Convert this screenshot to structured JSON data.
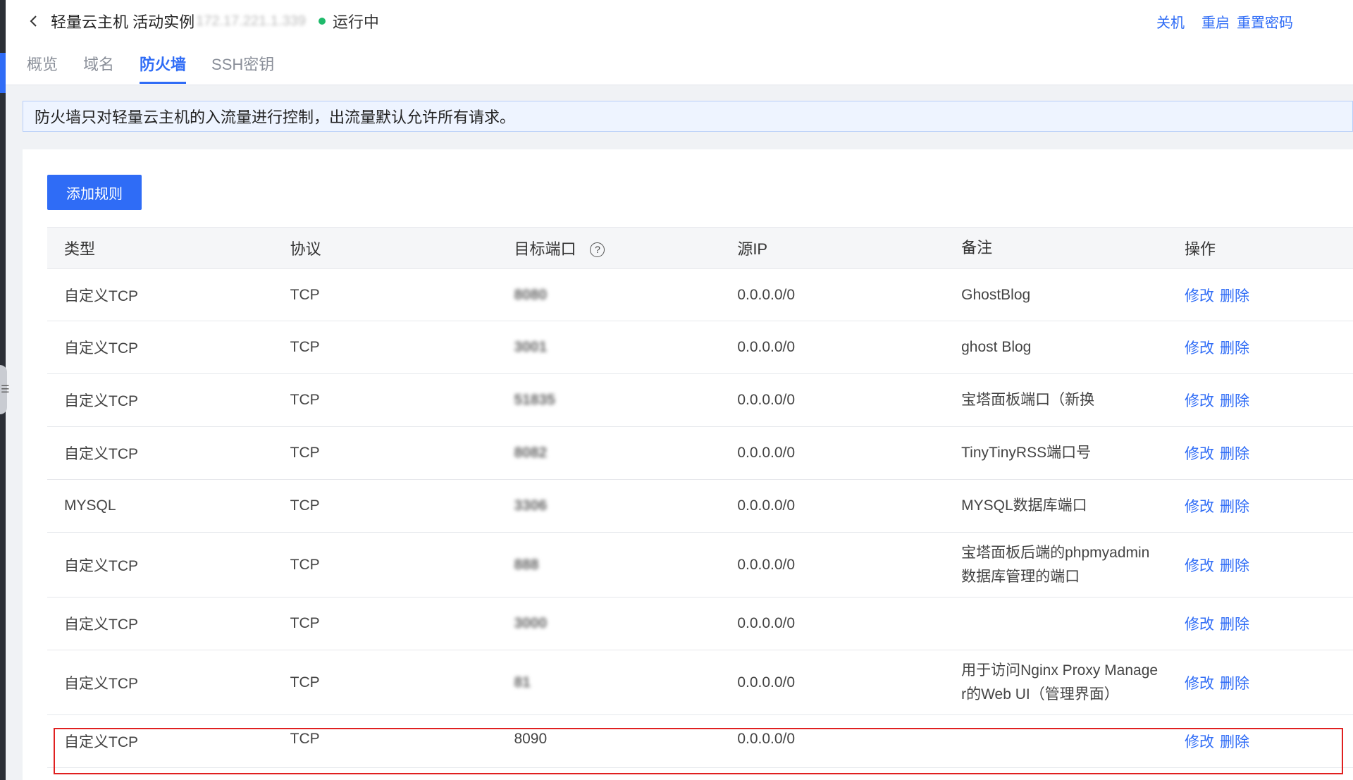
{
  "header": {
    "title": "轻量云主机 活动实例",
    "instance_id": "172.17.221.1.339",
    "status": "运行中",
    "actions": {
      "shutdown": "关机",
      "restart": "重启",
      "reset_password": "重置密码"
    }
  },
  "tabs": [
    "概览",
    "域名",
    "防火墙",
    "SSH密钥"
  ],
  "notice": "防火墙只对轻量云主机的入流量进行控制，出流量默认允许所有请求。",
  "add_rule_button": "添加规则",
  "table": {
    "columns": [
      "类型",
      "协议",
      "目标端口",
      "源IP",
      "备注",
      "操作"
    ],
    "edit_label": "修改",
    "delete_label": "删除",
    "rows": [
      {
        "type": "自定义TCP",
        "protocol": "TCP",
        "port": "8080",
        "source": "0.0.0.0/0",
        "note": "GhostBlog",
        "note2": ""
      },
      {
        "type": "自定义TCP",
        "protocol": "TCP",
        "port": "3001",
        "source": "0.0.0.0/0",
        "note": "ghost Blog",
        "note2": ""
      },
      {
        "type": "自定义TCP",
        "protocol": "TCP",
        "port": "51835",
        "source": "0.0.0.0/0",
        "note": "宝塔面板端口（新换",
        "note2": ""
      },
      {
        "type": "自定义TCP",
        "protocol": "TCP",
        "port": "8082",
        "source": "0.0.0.0/0",
        "note": "TinyTinyRSS端口号",
        "note2": ""
      },
      {
        "type": "MYSQL",
        "protocol": "TCP",
        "port": "3306",
        "source": "0.0.0.0/0",
        "note": "MYSQL数据库端口",
        "note2": ""
      },
      {
        "type": "自定义TCP",
        "protocol": "TCP",
        "port": "888",
        "source": "0.0.0.0/0",
        "note": "宝塔面板后端的phpmyadmin",
        "note2": "数据库管理的端口"
      },
      {
        "type": "自定义TCP",
        "protocol": "TCP",
        "port": "3000",
        "source": "0.0.0.0/0",
        "note": "",
        "note2": ""
      },
      {
        "type": "自定义TCP",
        "protocol": "TCP",
        "port": "81",
        "source": "0.0.0.0/0",
        "note": "用于访问Nginx Proxy Manage",
        "note2": "r的Web UI（管理界面）"
      },
      {
        "type": "自定义TCP",
        "protocol": "TCP",
        "port": "8090",
        "source": "0.0.0.0/0",
        "note": "",
        "note2": ""
      }
    ]
  },
  "colors": {
    "accent": "#2f6cf6",
    "status_running": "#1fba6b",
    "highlight_border": "#e02020"
  }
}
